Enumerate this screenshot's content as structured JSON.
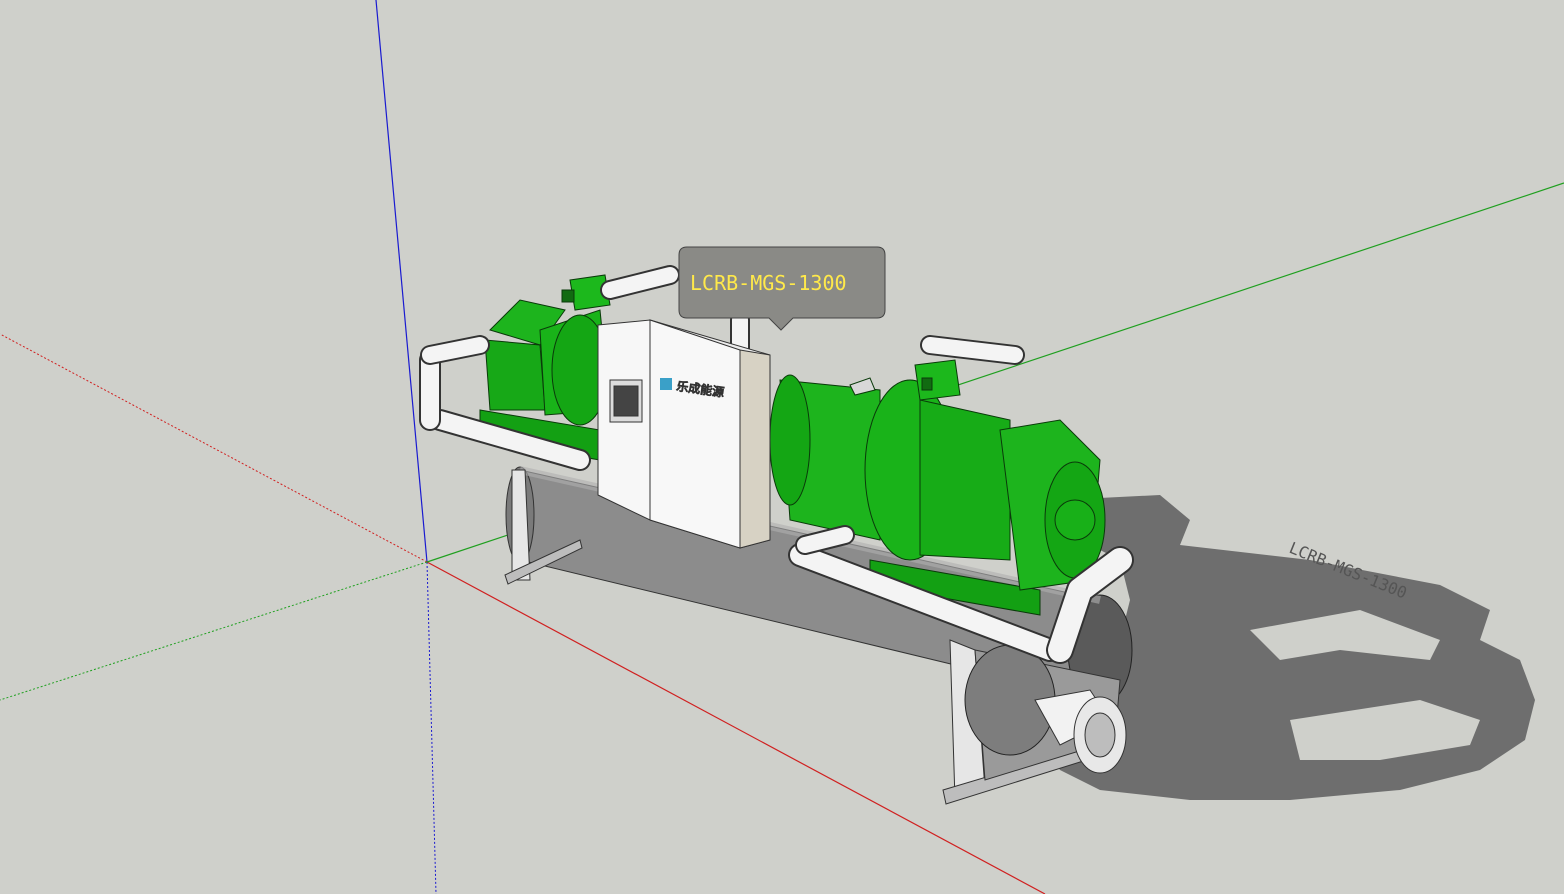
{
  "model_label": {
    "text": "LCRB-MGS-1300"
  },
  "shadow_label": {
    "text": "LCRB-MGS-1300"
  },
  "control_panel": {
    "brand_text": "乐成能源"
  },
  "colors": {
    "background": "#cfd0cb",
    "axis_red": "#d00000",
    "axis_green": "#00a000",
    "axis_blue": "#0000d0",
    "compressor_green": "#19b319",
    "pipe_white": "#f4f4f4",
    "vessel_gray": "#8c8c8c",
    "shadow_gray": "#6e6e6e",
    "label_bg": "#8a8a86",
    "label_text": "#ffe94a"
  }
}
